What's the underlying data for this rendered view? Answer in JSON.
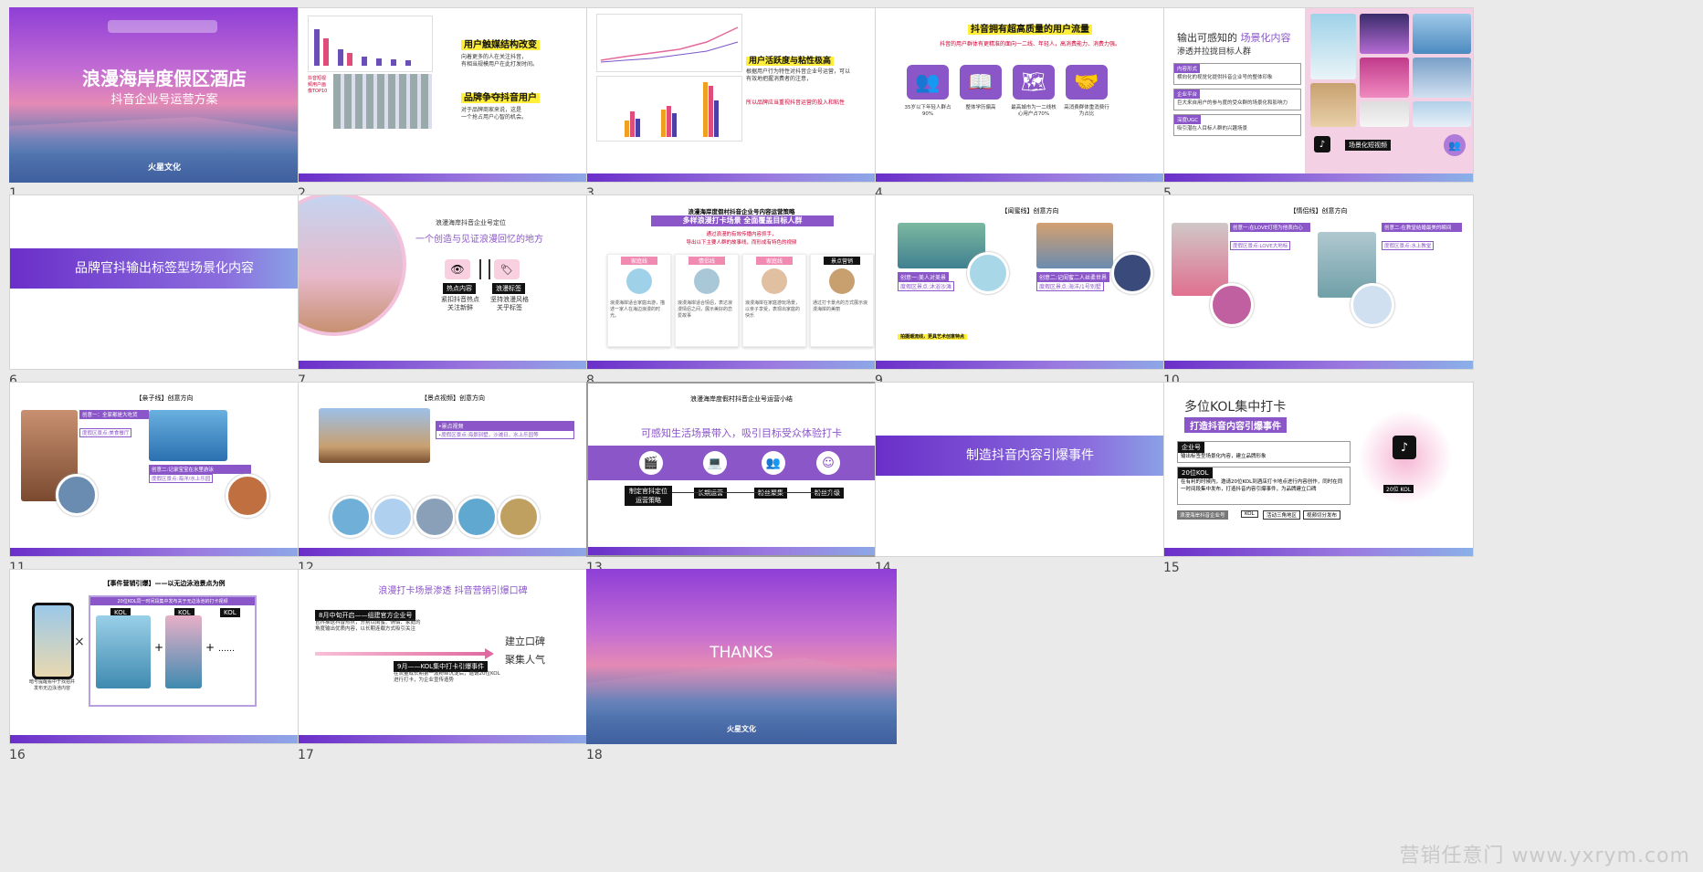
{
  "watermark": "营销任意门 www.yxrym.com",
  "slides": [
    {
      "num": "1",
      "title": "浪漫海岸度假区酒店",
      "subtitle": "抖音企业号运营方案",
      "brand": "火星文化"
    },
    {
      "num": "2",
      "h1": "用户触媒结构改变",
      "t1": "向着更多的人在关注抖音，",
      "t1b": "有相当规模用户在此打发时间。",
      "h2": "品牌争夺抖音用户",
      "t2": "对于品牌商家来说，这是",
      "t2b": "一个抢占用户心智的机会。",
      "chart_tag": "抖音短视频用户画像TOP10"
    },
    {
      "num": "3",
      "h1": "用户活跃度与粘性极高",
      "t1": "根据用户行为特性对抖音企业号运营，可以",
      "t1b": "有效地把握消费者的注意，",
      "t2": "所以品牌应当重视抖音运营的投入和粘性"
    },
    {
      "num": "4",
      "title": "抖音拥有超高质量的用户流量",
      "sub": "抖音的用户群体有更精准的面向一二线、年轻人，高消费能力、消费力强。",
      "tiles": [
        {
          "icon": "👥",
          "cap": "35岁以下年轻人群占90%"
        },
        {
          "icon": "📖",
          "cap": "整体学历偏高"
        },
        {
          "icon": "🗺",
          "cap": "最高城市为一二线核心用户占70%"
        },
        {
          "icon": "🤝",
          "cap": "高消费群体重消费行为占比"
        }
      ]
    },
    {
      "num": "5",
      "title1": "输出可感知的",
      "title2": "场景化内容",
      "title3": "渗透并拉拢目标人群",
      "rows": [
        {
          "h": "内容形式",
          "t": "横向化的视觉化提供抖音企业号的整体印象"
        },
        {
          "h": "企业平台",
          "t": "巨大来自用户的参与度的受众群的场景化和影响力"
        },
        {
          "h": "深度UGC",
          "t": "吸引潜在人目标人群的兴趣场景"
        }
      ],
      "badge": "场景化短视频"
    },
    {
      "num": "6",
      "title": "品牌官抖输出标签型场景化内容"
    },
    {
      "num": "7",
      "title": "浪漫海岸抖音企业号定位",
      "big": "一个创造与见证浪漫回忆的地方",
      "lab1": "热点内容",
      "lab2": "浪漫标签",
      "cap1": "紧扣抖音热点\n关注新鲜",
      "cap2": "坚持浪漫风格\n关乎标签"
    },
    {
      "num": "8",
      "title": "浪漫海岸度假村抖音企业号内容运营策略",
      "hl": "多样浪漫打卡场景 全面覆盖目标人群",
      "sub1": "通过浪漫的有效传播内容抓手，",
      "sub2": "导出以下主要人群的故事线，而形成有特色的视频",
      "cards": [
        {
          "tag": "家庭线",
          "txt": "浪漫海岸适合家庭出游，描述一家人在海边浪漫的时光。"
        },
        {
          "tag": "情侣线",
          "txt": "浪漫海岸适合情侣，表达浪漫情侣之间，展示美好的恋爱故事"
        },
        {
          "tag": "家庭线",
          "txt": "浪漫海岸在家庭游玩场景，以亲子享受，表现出家庭的快乐"
        },
        {
          "tag": "景点营销",
          "txt": "通过打卡景点的方式展示浪漫海岸的美丽"
        }
      ]
    },
    {
      "num": "9",
      "title": "【闺蜜线】创意方向",
      "c1h": "创意一:美人对美景",
      "c1s": "度假区景点:沐浴沙滩",
      "c2h": "创意二:记闺蜜二人丝柔世界",
      "c2s": "度假区景点:海洋/1号别墅",
      "tag": "拍摄潮流线，更具艺术创意特点"
    },
    {
      "num": "10",
      "title": "【情侣线】创意方向",
      "c1h": "创意一:在LOVE灯塔为他表白心",
      "c1s": "度假区景点:LOVE大地标",
      "c2h": "创意二:在教堂结婚最美的瞬间",
      "c2s": "度假区景点:水上教堂"
    },
    {
      "num": "11",
      "title": "【亲子线】创意方向",
      "c1h": "创意一：全家都是大吃货",
      "c1s": "度假区景点:美食餐厅",
      "c2h": "创意二:记录宝宝在水里游泳",
      "c2s": "度假区景点:海洋/水上乐园"
    },
    {
      "num": "12",
      "title": "【景点视频】创意方向",
      "h": "•景点视频",
      "t": "•度假区景点:海景别墅，沙滩日，水上乐园等"
    },
    {
      "num": "13",
      "title": "浪漫海岸度假村抖音企业号运营小结",
      "big": "可感知生活场景带入，吸引目标受众体验打卡",
      "steps": [
        "制定官抖定位运营策略",
        "长期运营",
        "粉丝聚集",
        "粉丝升级"
      ]
    },
    {
      "num": "14",
      "title": "制造抖音内容引爆事件"
    },
    {
      "num": "15",
      "title": "多位KOL集中打卡",
      "hl": "打造抖音内容引爆事件",
      "b1h": "企业号",
      "b1t": "输出标签型场景化内容，建立品牌形象",
      "b2h": "20位KOL",
      "b2t": "在有利的时候内，邀请20位KOL到酒店打卡地点进行内容创作，同时在同一时间段集中发布，打造抖音内容引爆事件，为品牌建立口碑",
      "kol": "20位 KOL",
      "chips": [
        "浪漫海岸抖音企业号",
        "KOL",
        "活动三角地区",
        "视频切分发布"
      ]
    },
    {
      "num": "16",
      "title": "【事件营销引爆】——以无边泳池景点为例",
      "band": "20位KOL同一时间段集中发布关于无边泳池的打卡视频",
      "kol": "KOL",
      "cap1": "暗号提醒看中于找拍并发布无边泳池内容",
      "dots": "……"
    },
    {
      "num": "17",
      "title": "浪漫打卡场景渗透  抖音营销引爆口碑",
      "s1": "8月中旬开启——组建官方企业号",
      "t1": "官抖推送抖音热点，分别以闺蜜、情侣、家庭的角度输出优质内容，以长期连载方式吸引关注",
      "s2": "9月——KOL集中打卡引爆事件",
      "t2": "在流量成长期第一波粉丝沉淀后，邀请20位KOL进行打卡，为企业宣传造势",
      "r1": "建立口碑",
      "r2": "聚集人气"
    },
    {
      "num": "18",
      "title": "THANKS",
      "brand": "火星文化"
    }
  ]
}
